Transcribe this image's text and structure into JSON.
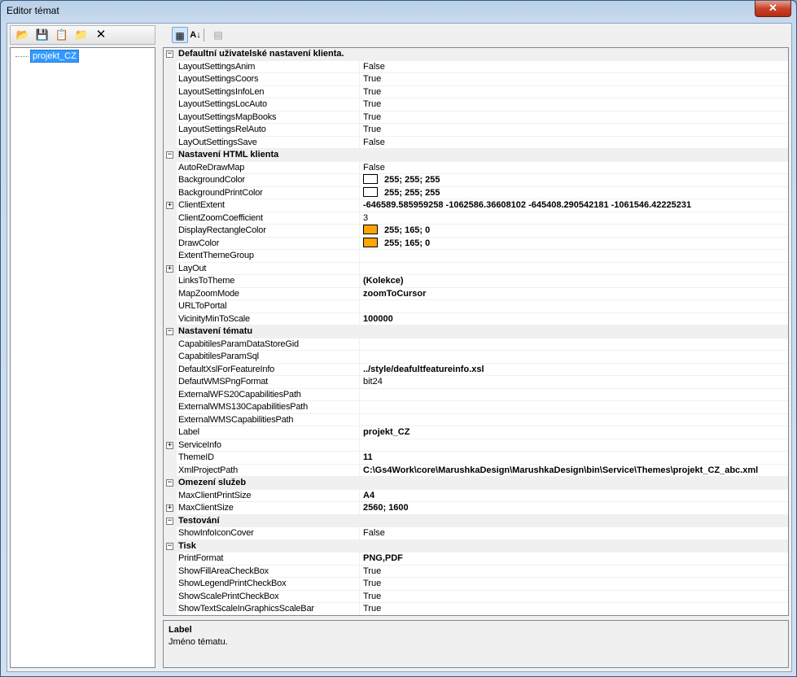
{
  "window": {
    "title": "Editor témat",
    "close_label": "✕"
  },
  "left_toolbar": [
    {
      "name": "open-folder-icon",
      "glyph": "📂"
    },
    {
      "name": "save-icon",
      "glyph": "💾"
    },
    {
      "name": "copy-icon",
      "glyph": "📋"
    },
    {
      "name": "new-folder-icon",
      "glyph": "📁"
    },
    {
      "name": "delete-icon",
      "glyph": "✕"
    }
  ],
  "tree": {
    "node_label": "projekt_CZ"
  },
  "property_toolbar": {
    "categorized_glyph": "▦",
    "alphabetical_glyph": "A↓",
    "pages_glyph": "▤"
  },
  "grid": [
    {
      "type": "category",
      "name": "Defaultní uživatelské nastavení klienta."
    },
    {
      "type": "prop",
      "name": "LayoutSettingsAnim",
      "value": "False"
    },
    {
      "type": "prop",
      "name": "LayoutSettingsCoors",
      "value": "True"
    },
    {
      "type": "prop",
      "name": "LayoutSettingsInfoLen",
      "value": "True"
    },
    {
      "type": "prop",
      "name": "LayoutSettingsLocAuto",
      "value": "True"
    },
    {
      "type": "prop",
      "name": "LayoutSettingsMapBooks",
      "value": "True"
    },
    {
      "type": "prop",
      "name": "LayoutSettingsRelAuto",
      "value": "True"
    },
    {
      "type": "prop",
      "name": "LayOutSettingsSave",
      "value": "False"
    },
    {
      "type": "category",
      "name": "Nastavení HTML klienta"
    },
    {
      "type": "prop",
      "name": "AutoReDrawMap",
      "value": "False"
    },
    {
      "type": "prop",
      "name": "BackgroundColor",
      "value": "255; 255; 255",
      "bold": true,
      "swatch": "#ffffff"
    },
    {
      "type": "prop",
      "name": "BackgroundPrintColor",
      "value": "255; 255; 255",
      "bold": true,
      "swatch": "#ffffff"
    },
    {
      "type": "prop",
      "name": "ClientExtent",
      "value": "-646589.585959258 -1062586.36608102 -645408.290542181 -1061546.42225231",
      "bold": true,
      "expandable": true
    },
    {
      "type": "prop",
      "name": "ClientZoomCoefficient",
      "value": "3"
    },
    {
      "type": "prop",
      "name": "DisplayRectangleColor",
      "value": "255; 165; 0",
      "bold": true,
      "swatch": "#ffa500"
    },
    {
      "type": "prop",
      "name": "DrawColor",
      "value": "255; 165; 0",
      "bold": true,
      "swatch": "#ffa500"
    },
    {
      "type": "prop",
      "name": "ExtentThemeGroup",
      "value": ""
    },
    {
      "type": "prop",
      "name": "LayOut",
      "value": "",
      "expandable": true
    },
    {
      "type": "prop",
      "name": "LinksToTheme",
      "value": "(Kolekce)",
      "bold": true
    },
    {
      "type": "prop",
      "name": "MapZoomMode",
      "value": "zoomToCursor",
      "bold": true
    },
    {
      "type": "prop",
      "name": "URLToPortal",
      "value": ""
    },
    {
      "type": "prop",
      "name": "VicinityMinToScale",
      "value": "100000",
      "bold": true
    },
    {
      "type": "category",
      "name": "Nastavení tématu"
    },
    {
      "type": "prop",
      "name": "CapabitilesParamDataStoreGid",
      "value": ""
    },
    {
      "type": "prop",
      "name": "CapabitilesParamSql",
      "value": ""
    },
    {
      "type": "prop",
      "name": "DefaultXslForFeatureInfo",
      "value": "../style/deafultfeatureinfo.xsl",
      "bold": true
    },
    {
      "type": "prop",
      "name": "DefautWMSPngFormat",
      "value": "bit24"
    },
    {
      "type": "prop",
      "name": "ExternalWFS20CapabilitiesPath",
      "value": ""
    },
    {
      "type": "prop",
      "name": "ExternalWMS130CapabilitiesPath",
      "value": ""
    },
    {
      "type": "prop",
      "name": "ExternalWMSCapabilitiesPath",
      "value": ""
    },
    {
      "type": "prop",
      "name": "Label",
      "value": "projekt_CZ",
      "bold": true
    },
    {
      "type": "prop",
      "name": "ServiceInfo",
      "value": "",
      "expandable": true
    },
    {
      "type": "prop",
      "name": "ThemeID",
      "value": "11",
      "bold": true
    },
    {
      "type": "prop",
      "name": "XmlProjectPath",
      "value": "C:\\Gs4Work\\core\\MarushkaDesign\\MarushkaDesign\\bin\\Service\\Themes\\projekt_CZ_abc.xml",
      "bold": true
    },
    {
      "type": "category",
      "name": "Omezení služeb"
    },
    {
      "type": "prop",
      "name": "MaxClientPrintSize",
      "value": "A4",
      "bold": true
    },
    {
      "type": "prop",
      "name": "MaxClientSize",
      "value": "2560; 1600",
      "bold": true,
      "expandable": true
    },
    {
      "type": "category",
      "name": "Testování"
    },
    {
      "type": "prop",
      "name": "ShowInfoIconCover",
      "value": "False"
    },
    {
      "type": "category",
      "name": "Tisk"
    },
    {
      "type": "prop",
      "name": "PrintFormat",
      "value": "PNG,PDF",
      "bold": true
    },
    {
      "type": "prop",
      "name": "ShowFillAreaCheckBox",
      "value": "True"
    },
    {
      "type": "prop",
      "name": "ShowLegendPrintCheckBox",
      "value": "True"
    },
    {
      "type": "prop",
      "name": "ShowScalePrintCheckBox",
      "value": "True"
    },
    {
      "type": "prop",
      "name": "ShowTextScaleInGraphicsScaleBar",
      "value": "True"
    }
  ],
  "help": {
    "title": "Label",
    "description": "Jméno tématu."
  }
}
